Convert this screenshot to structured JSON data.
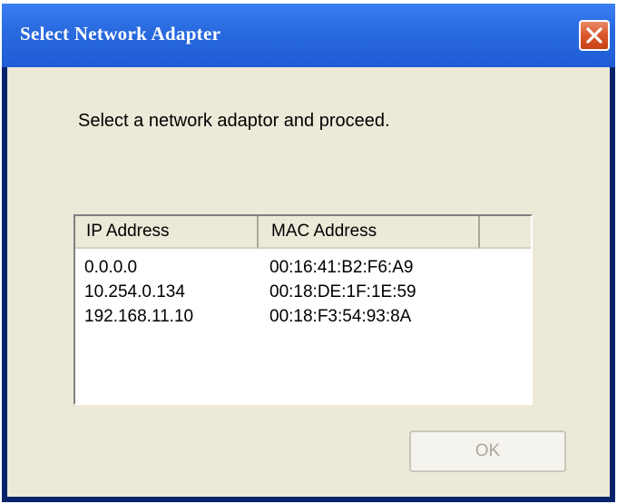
{
  "window": {
    "title": "Select Network Adapter"
  },
  "prompt": "Select a network adaptor and proceed.",
  "table": {
    "columns": [
      "IP Address",
      "MAC Address",
      ""
    ],
    "rows": [
      {
        "ip": "0.0.0.0",
        "mac": "00:16:41:B2:F6:A9"
      },
      {
        "ip": "10.254.0.134",
        "mac": "00:18:DE:1F:1E:59"
      },
      {
        "ip": "192.168.11.10",
        "mac": "00:18:F3:54:93:8A"
      }
    ]
  },
  "buttons": {
    "ok": "OK"
  },
  "colors": {
    "titlebar": "#2a6be0",
    "close": "#d9572a",
    "dialog_bg": "#ece9d8",
    "disabled_text": "#aca899"
  },
  "icons": {
    "close": "close-icon"
  }
}
